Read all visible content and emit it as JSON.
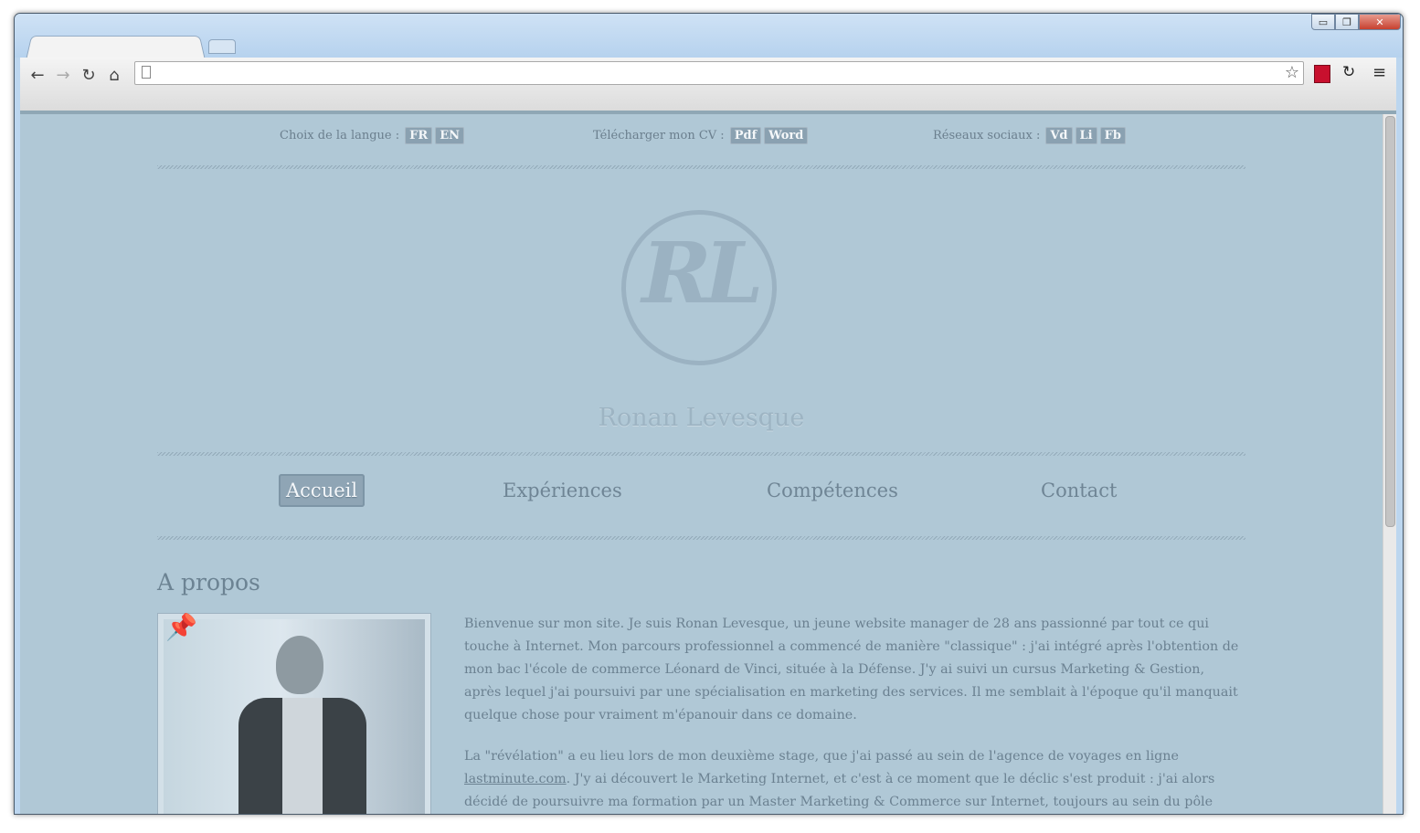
{
  "browser": {
    "window_controls": {
      "minimize": "▭",
      "maximize": "❐",
      "close": "✕"
    },
    "nav": {
      "back": "←",
      "forward": "→",
      "reload": "↻",
      "home": "⌂"
    },
    "omnibox": {
      "value": ""
    },
    "bookmark_icon": "☆",
    "menu_icon": "≡",
    "extension_icon": "↻"
  },
  "topbar": {
    "language_label": "Choix de la langue :",
    "languages": [
      "FR",
      "EN"
    ],
    "cv_label": "Télécharger mon CV :",
    "cv_formats": [
      "Pdf",
      "Word"
    ],
    "social_label": "Réseaux sociaux :",
    "socials": [
      "Vd",
      "Li",
      "Fb"
    ]
  },
  "logo": {
    "monogram": "RL"
  },
  "site_name": "Ronan Levesque",
  "nav": {
    "items": [
      "Accueil",
      "Expériences",
      "Compétences",
      "Contact"
    ],
    "active": "Accueil"
  },
  "about": {
    "title": "A propos",
    "paragraph1": "Bienvenue sur mon site. Je suis Ronan Levesque, un jeune website manager de 28 ans passionné par tout ce qui touche à Internet. Mon parcours professionnel a commencé de manière \"classique\" : j'ai intégré après l'obtention de mon bac l'école de commerce Léonard de Vinci, située à la Défense. J'y ai suivi un cursus Marketing & Gestion, après lequel j'ai poursuivi par une spécialisation en marketing des services. Il me semblait à l'époque qu'il manquait quelque chose pour vraiment m'épanouir dans ce domaine.",
    "paragraph2_before": "La \"révélation\" a eu lieu lors de mon deuxième stage, que j'ai passé au sein de l'agence de voyages en ligne ",
    "paragraph2_link": "lastminute.com",
    "paragraph2_after": ". J'y ai découvert le Marketing Internet, et c'est à ce moment que le déclic s'est produit : j'ai alors décidé de poursuivre ma formation par un Master Marketing & Commerce sur Internet, toujours au sein du pôle universitaire Léonard de Vinci."
  }
}
